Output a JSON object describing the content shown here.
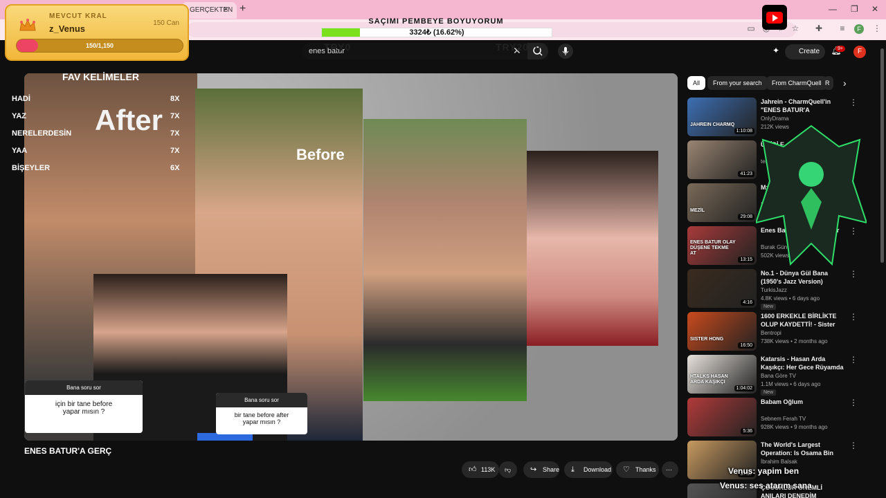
{
  "browser": {
    "tab_title": "GERÇEKTEN",
    "tab_close": "×",
    "new_tab": "+",
    "minimize": "—",
    "maximize": "❐",
    "close": "✕",
    "profile_letter": "F"
  },
  "stream_goal": {
    "title": "SAÇIMI PEMBEYE BOYUYORUM",
    "progress_text": "3324₺ (16.62%)",
    "progress_fraction": 0.1662
  },
  "king_card": {
    "label": "MEVCUT KRAL",
    "name": "z_Venus",
    "can": "150 Can",
    "bar_text": "150/1,150",
    "progress_fraction": 0.1304
  },
  "youtube_header": {
    "search_value": "enes batur",
    "ghost_left": "TRY0",
    "ghost_right": "TRY20000",
    "create_label": "Create",
    "notification_count": "9+",
    "avatar_letter": "F"
  },
  "overlay_keywords": {
    "title": "FAV KELİMELER",
    "items": [
      {
        "word": "HADİ",
        "count": "8X"
      },
      {
        "word": "YAZ",
        "count": "7X"
      },
      {
        "word": "NERELERDESİN",
        "count": "7X"
      },
      {
        "word": "YAA",
        "count": "7X"
      },
      {
        "word": "BİŞEYLER",
        "count": "6X"
      }
    ]
  },
  "video": {
    "after_text": "After",
    "before_text": "Before",
    "title_partial": "ENES BATUR'A GERÇ",
    "question_cards": [
      {
        "head": "Bana soru sor",
        "body": "için bir tane before\nyapar mısın ?"
      },
      {
        "head": "Bana soru sor",
        "body": "bir tane before after\nyapar mısın ?"
      }
    ]
  },
  "actions": {
    "likes": "113K",
    "share": "Share",
    "download": "Download",
    "thanks": "Thanks",
    "more": "⋯"
  },
  "sidebar": {
    "chips": [
      "All",
      "From your search",
      "From CharmQuell",
      "R"
    ],
    "chip_next": "›",
    "videos": [
      {
        "title": "Jahrein - CharmQuell'in \"ENES BATUR'A GERÇEKTEN NE ...",
        "channel": "OnlyDrama",
        "meta": "212K views",
        "duration": "1:10:08",
        "thumb_text": "JAHREIN CHARMQ",
        "color": "#3d6fb3"
      },
      {
        "title": "ÜMİDİ E",
        "channel": "testo",
        "meta": "",
        "duration": "41:23",
        "thumb_text": "",
        "color": "#9a8572"
      },
      {
        "title": "Mz: Türk",
        "channel": "S.Ü",
        "meta": "views",
        "duration": "29:08",
        "thumb_text": "MEZİL",
        "color": "#7a6a58"
      },
      {
        "title": "Enes Batur Doğru Yalanlar",
        "channel": "Burak Güng",
        "meta": "502K views",
        "duration": "13:15",
        "thumb_text": "ENES BATUR OLAY DÜŞENE TEKME AT",
        "color": "#a83a3a"
      },
      {
        "title": "No.1 - Dünya Gül Bana (1950's Jazz Version)",
        "channel": "TurkisJazz",
        "meta": "4.8K views • 6 days ago",
        "duration": "4:16",
        "thumb_text": "",
        "color": "#3a2b1e",
        "new": "New"
      },
      {
        "title": "1600 ERKEKLE BİRLİKTE OLUP KAYDETTİ! - Sister Hong",
        "channel": "Bentropi",
        "meta": "738K views • 2 months ago",
        "duration": "16:50",
        "thumb_text": "SISTER HONG",
        "color": "#c94a1d"
      },
      {
        "title": "Katarsis - Hasan Arda Kaşıkçı: Her Gece Rüyamda ...",
        "channel": "Bana Göre TV",
        "meta": "1.1M views • 6 days ago",
        "duration": "1:04:02",
        "thumb_text": "HTALKS HASAN ARDA KAŞIKÇI",
        "color": "#e8e2dc",
        "new": "New"
      },
      {
        "title": "Babam Oğlum",
        "channel": "Sebnem Ferah TV",
        "meta": "928K views • 9 months ago",
        "duration": "5:36",
        "thumb_text": "",
        "color": "#b23a3a"
      },
      {
        "title": "The World's Largest Operation: Is Osama Bin Laden Really ...",
        "channel": "İbrahim Balsak",
        "meta": "",
        "duration": "37:37",
        "thumb_text": "",
        "color": "#c89a60"
      },
      {
        "title": "ÇOCUKLUK ÖNEMLİ ANILARI DENEDİM",
        "channel": "",
        "meta": "",
        "duration": "",
        "thumb_text": "",
        "color": "#555555"
      }
    ]
  },
  "chat_overlay": {
    "line1": "Venus: yapim ben",
    "line2": "Venus: ses atarım sana"
  },
  "colors": {
    "accent": "#ff0000",
    "goal_fill": "#7be01c",
    "king_fill": "#ee4464",
    "chrome_tabs": "#f4b7cf"
  }
}
